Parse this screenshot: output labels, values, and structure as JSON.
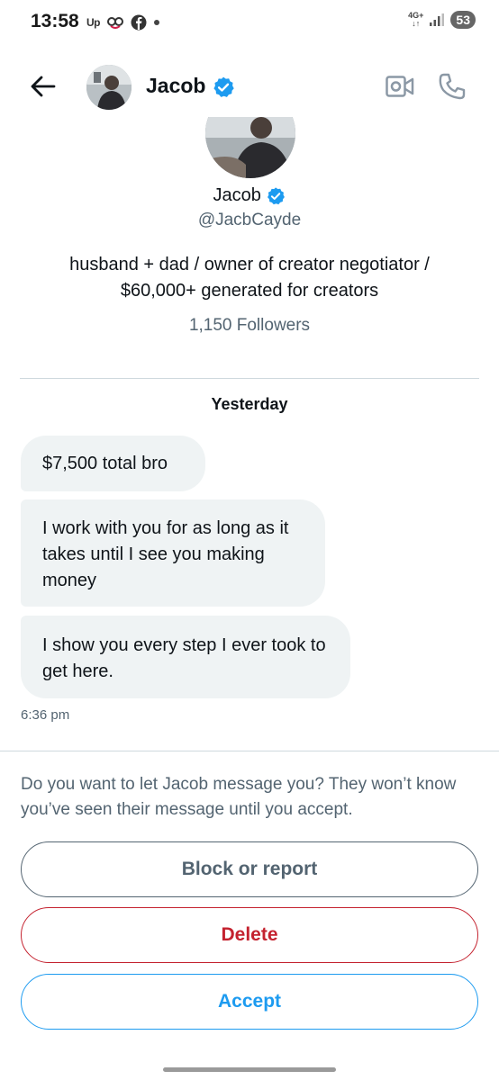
{
  "status_bar": {
    "time": "13:58",
    "app_badge": "Up",
    "network": "4G+",
    "battery": "53"
  },
  "header": {
    "name": "Jacob",
    "avatar_alt": "avatar"
  },
  "profile": {
    "name": "Jacob",
    "handle": "@JacbCayde",
    "bio_line1": "husband + dad / owner of creator negotiator /",
    "bio_line2": "$60,000+ generated for creators",
    "followers": "1,150 Followers"
  },
  "conversation": {
    "day_label": "Yesterday",
    "messages": [
      {
        "text": "$7,500 total bro"
      },
      {
        "text": "I work with you for as long as it takes until I see you making money"
      },
      {
        "text": "I show you every step I ever took to get here."
      }
    ],
    "time": "6:36 pm"
  },
  "request": {
    "prompt": "Do you want to let Jacob message you? They won’t know you’ve seen their message until you accept.",
    "block_label": "Block or report",
    "delete_label": "Delete",
    "accept_label": "Accept"
  },
  "colors": {
    "accent": "#1d9bf0",
    "danger": "#c4222f",
    "secondary_text": "#536471",
    "bubble_bg": "#eff3f4"
  }
}
